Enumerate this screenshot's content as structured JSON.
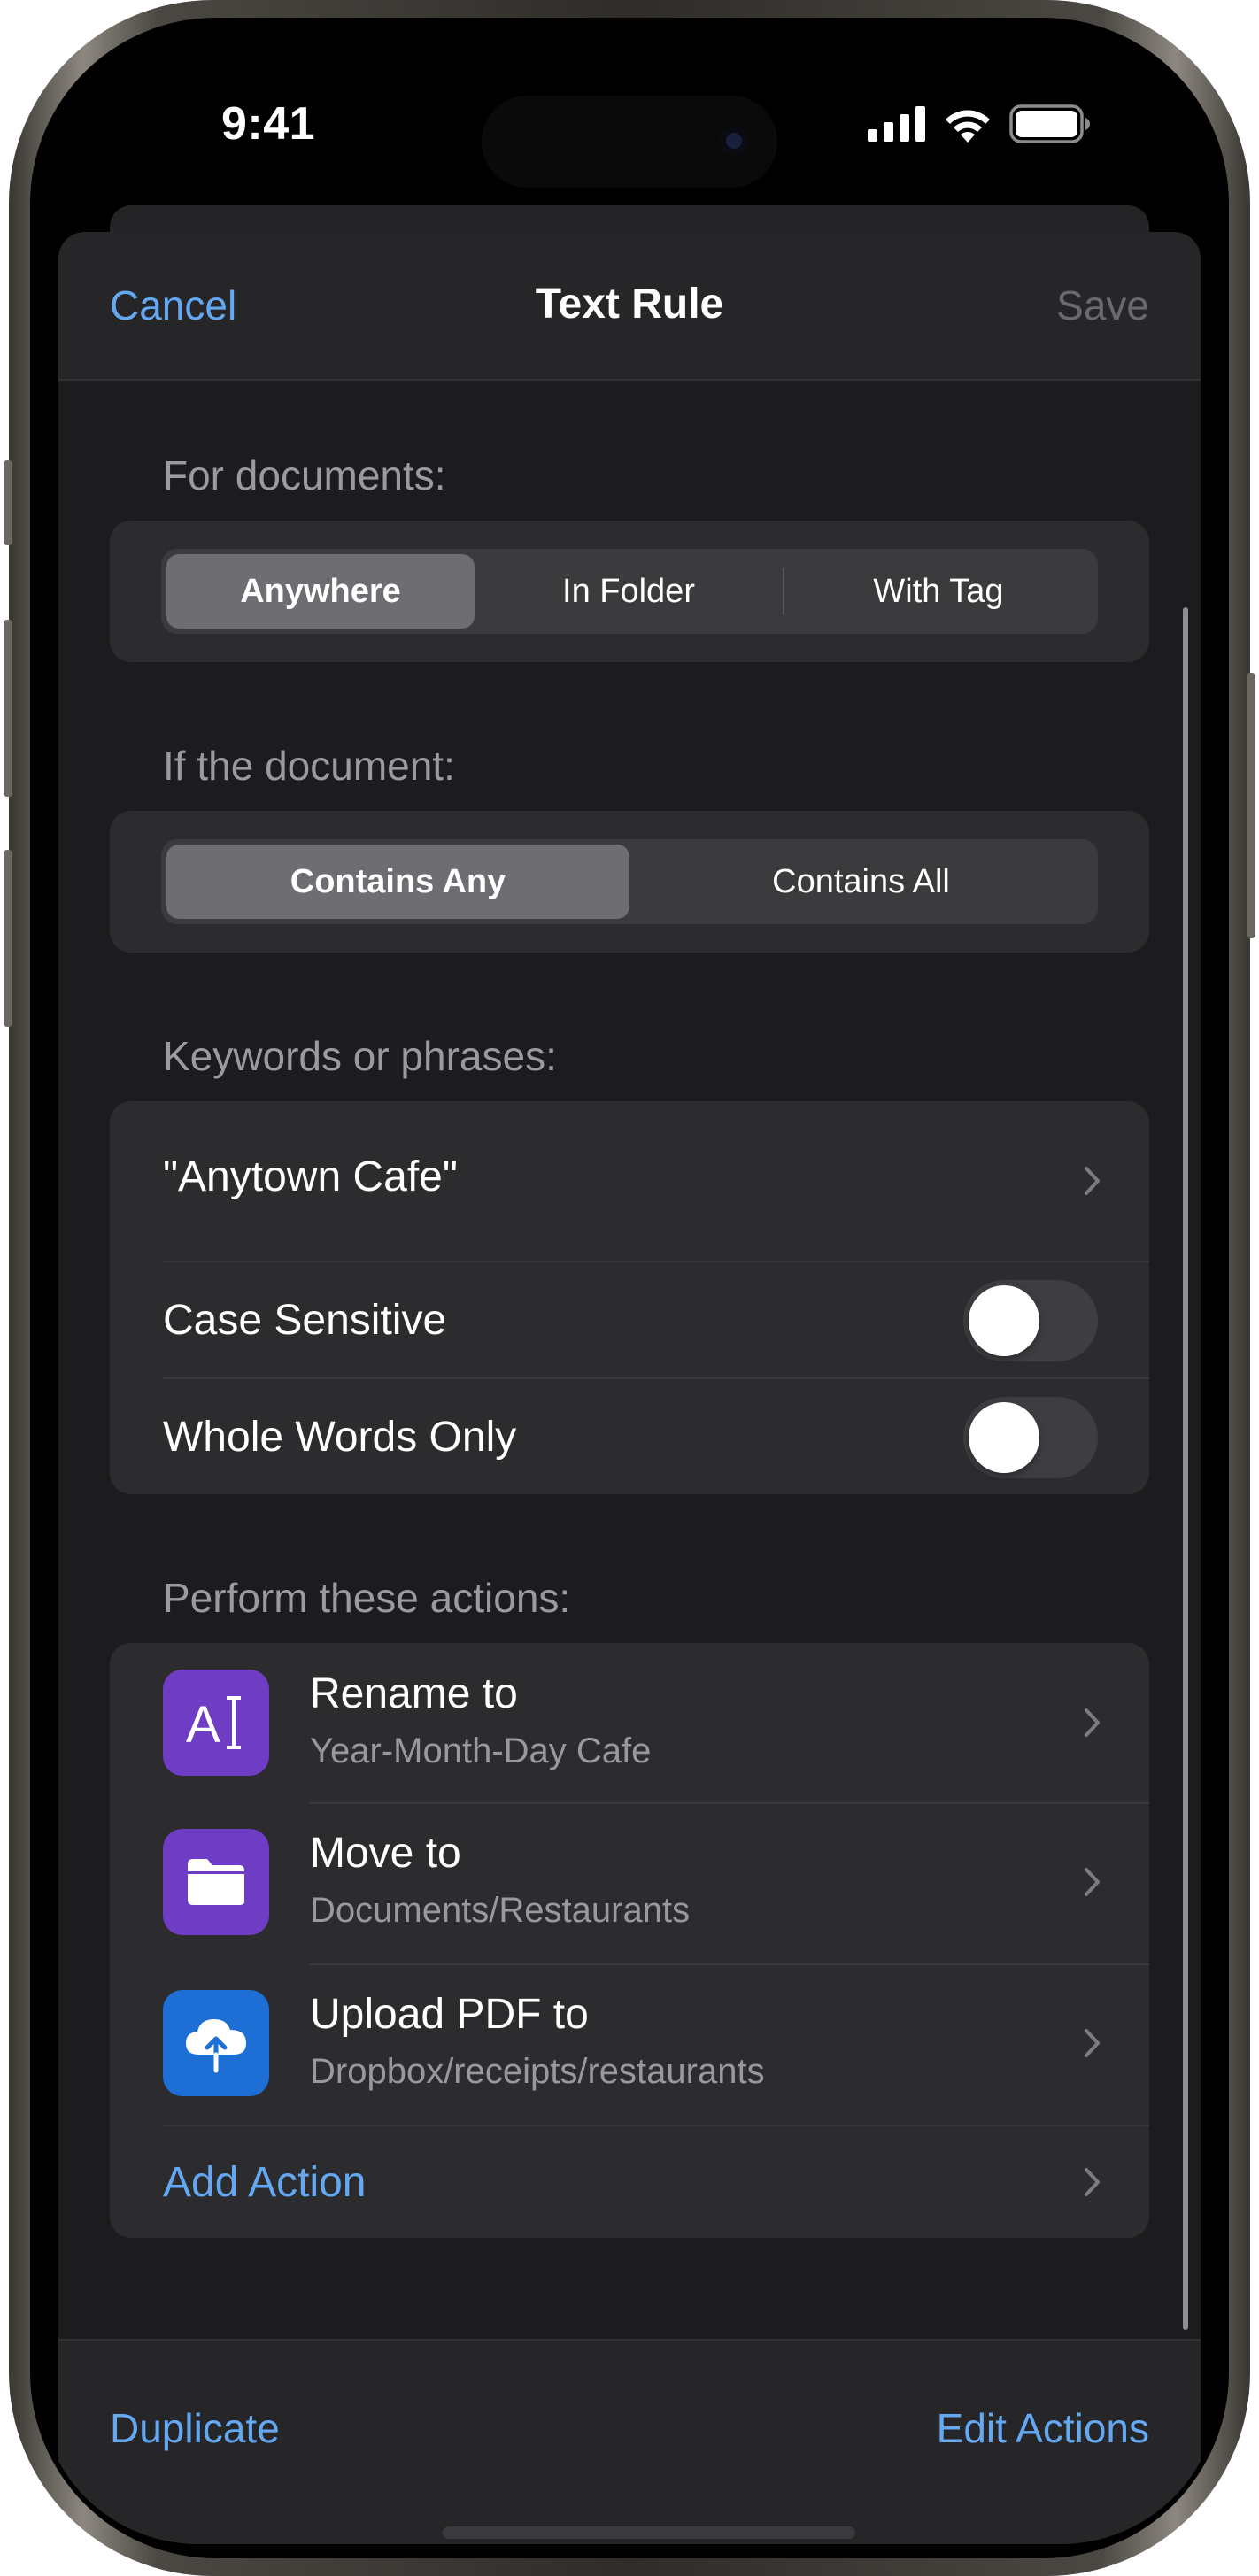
{
  "status_bar": {
    "time": "9:41"
  },
  "nav": {
    "cancel": "Cancel",
    "title": "Text Rule",
    "save": "Save"
  },
  "documents_section": {
    "header": "For documents:",
    "options": [
      "Anywhere",
      "In Folder",
      "With Tag"
    ],
    "selected": "Anywhere"
  },
  "condition_section": {
    "header": "If the document:",
    "options": [
      "Contains Any",
      "Contains All"
    ],
    "selected": "Contains Any"
  },
  "keywords_section": {
    "header": "Keywords or phrases:",
    "keyword": "\"Anytown Cafe\"",
    "case_sensitive": {
      "label": "Case Sensitive",
      "on": false
    },
    "whole_words": {
      "label": "Whole Words Only",
      "on": false
    }
  },
  "actions_section": {
    "header": "Perform these actions:",
    "items": [
      {
        "title": "Rename to",
        "subtitle": "Year-Month-Day Cafe",
        "icon": "rename-icon",
        "color": "#6f3cc4"
      },
      {
        "title": "Move to",
        "subtitle": "Documents/Restaurants",
        "icon": "folder-icon",
        "color": "#6f3cc4"
      },
      {
        "title": "Upload PDF to",
        "subtitle": "Dropbox/receipts/restaurants",
        "icon": "cloud-upload-icon",
        "color": "#1d6fd6"
      }
    ],
    "add_action": "Add Action"
  },
  "toolbar": {
    "duplicate": "Duplicate",
    "edit_actions": "Edit Actions"
  },
  "colors": {
    "accent": "#64a8f2",
    "background": "#1c1c1e",
    "group": "#2c2c2e"
  }
}
